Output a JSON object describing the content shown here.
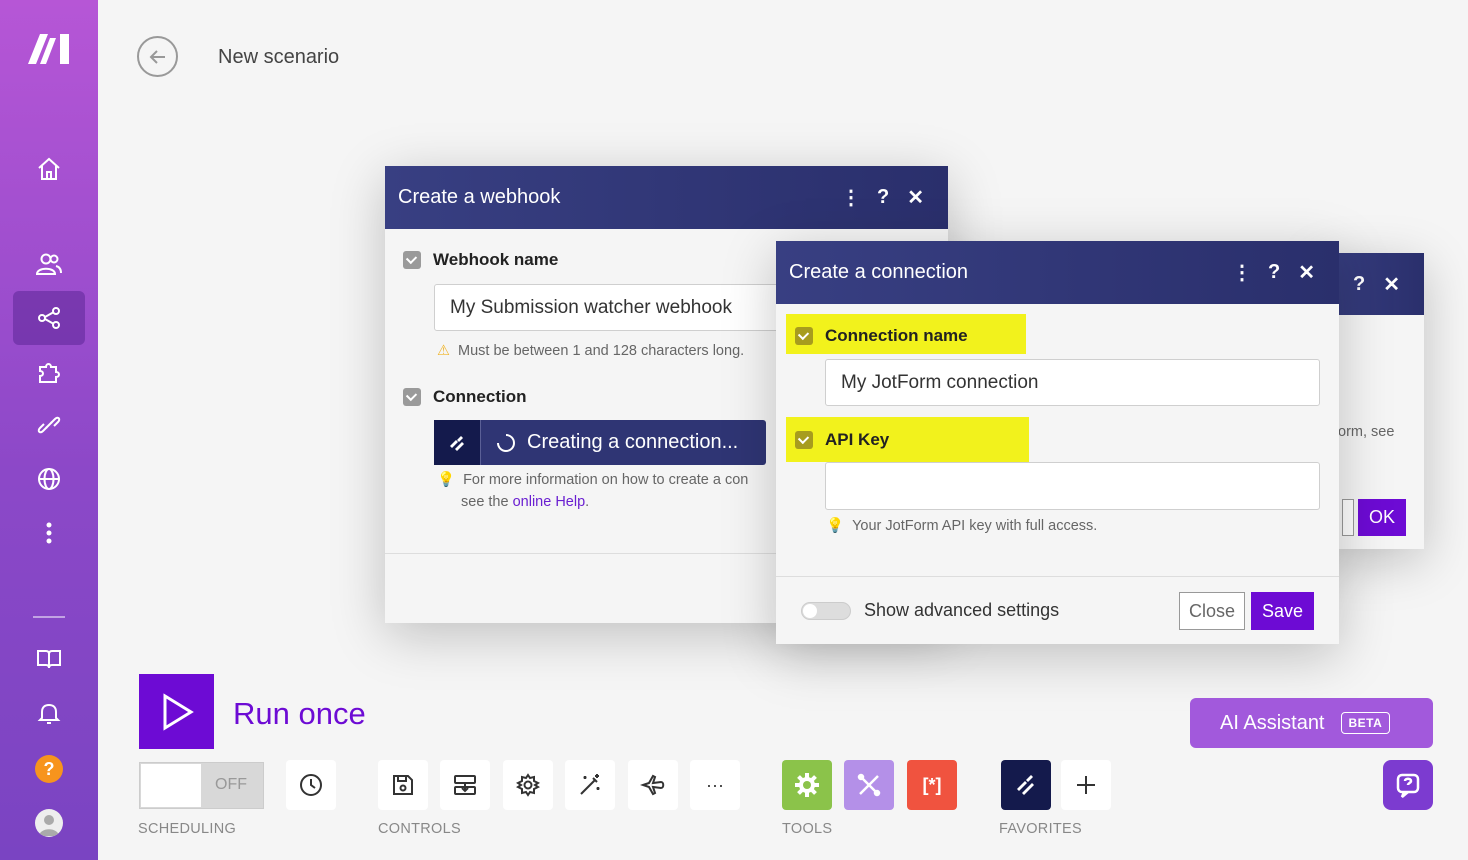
{
  "header": {
    "title": "New scenario"
  },
  "webhook_dialog": {
    "title": "Create a webhook",
    "webhook_name_label": "Webhook name",
    "webhook_name_value": "My Submission watcher webhook",
    "webhook_name_warning": "Must be between 1 and 128 characters long.",
    "connection_label": "Connection",
    "connection_button": "Creating a connection...",
    "connection_hint_line1": "For more information on how to create a con",
    "connection_hint_line2_prefix": "see the ",
    "connection_hint_link": "online Help",
    "connection_hint_line2_suffix": "."
  },
  "back_dialog": {
    "hint_fragment": "orm, see",
    "ok_label": "OK"
  },
  "connection_dialog": {
    "title": "Create a connection",
    "connection_name_label": "Connection name",
    "connection_name_value": "My JotForm connection",
    "api_key_label": "API Key",
    "api_key_value": "",
    "api_key_hint": "Your JotForm API key with full access.",
    "advanced_toggle_label": "Show advanced settings",
    "close_label": "Close",
    "save_label": "Save"
  },
  "toolbar": {
    "run_once_label": "Run once",
    "scheduling_toggle": "OFF",
    "scheduling_label": "SCHEDULING",
    "controls_label": "CONTROLS",
    "tools_label": "TOOLS",
    "favorites_label": "FAVORITES",
    "ai_assistant_label": "AI Assistant",
    "ai_badge": "BETA",
    "more_label": "···"
  },
  "colors": {
    "accent": "#6d0bd4",
    "dialog_header": "#2f3574",
    "highlight": "#f2f21c",
    "tool_green": "#8bc34a",
    "tool_lavender": "#b490e8",
    "tool_red": "#f0533f",
    "favorite_navy": "#141a4c"
  },
  "icons": [
    "logo-icon",
    "home-icon",
    "team-icon",
    "scenarios-icon",
    "apps-icon",
    "connections-icon",
    "webhooks-icon",
    "more-icon",
    "docs-icon",
    "bell-icon",
    "help-icon",
    "avatar",
    "back-arrow-icon",
    "play-icon",
    "clock-icon",
    "save-icon",
    "blueprint-icon",
    "settings-icon",
    "magic-wand-icon",
    "airplane-icon",
    "gear-tool-icon",
    "tools-icon",
    "text-parser-icon",
    "jotform-icon",
    "plus-icon",
    "chat-icon"
  ]
}
